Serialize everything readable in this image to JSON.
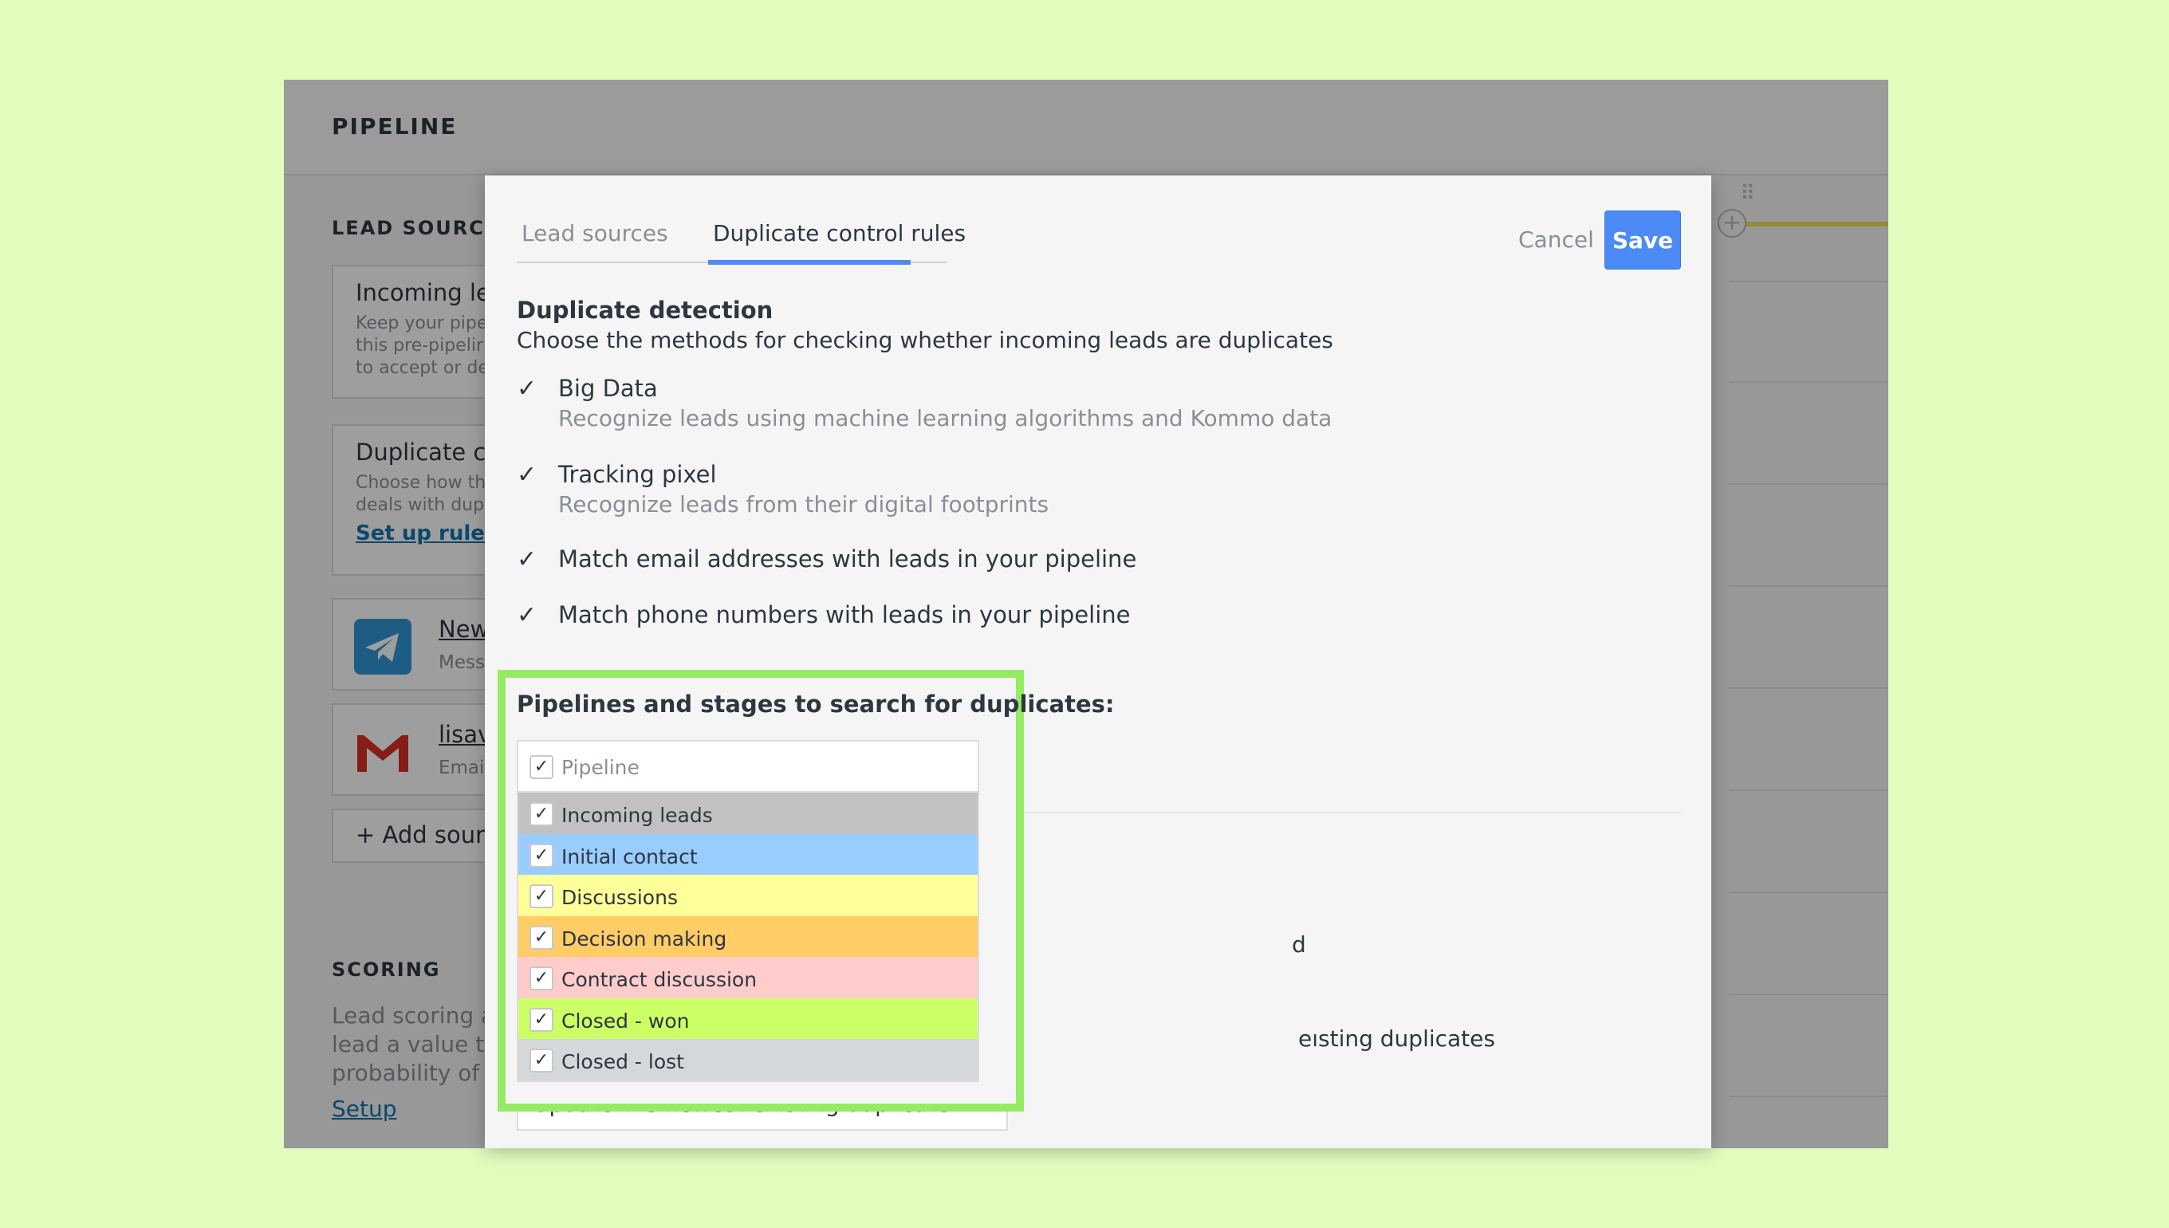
{
  "background": {
    "header": {
      "title": "PIPELINE"
    },
    "lead_sources": {
      "title": "LEAD SOURCES",
      "incoming_card": {
        "title": "Incoming lea",
        "desc": [
          "Keep your pipe",
          "this pre-pipelir",
          "to accept or de"
        ]
      },
      "duplicate_card": {
        "title": "Duplicate cor",
        "desc": [
          "Choose how th",
          "deals with dup"
        ],
        "link": "Set up rules"
      },
      "sources": [
        {
          "name": "Newb",
          "sub": "Messe",
          "icon": "telegram-icon",
          "color": "#2f97d3"
        },
        {
          "name": "lisave",
          "sub": "Email",
          "icon": "gmail-icon",
          "color": "#d93025"
        }
      ],
      "add_source": "Add sourc"
    },
    "scoring": {
      "title": "SCORING",
      "desc": [
        "Lead scoring all",
        "lead a value tha",
        "probability of c"
      ],
      "link": "Setup"
    }
  },
  "modal": {
    "tabs": [
      {
        "label": "Lead sources",
        "active": false
      },
      {
        "label": "Duplicate control rules",
        "active": true
      }
    ],
    "cancel_label": "Cancel",
    "save_label": "Save",
    "detection": {
      "title": "Duplicate detection",
      "desc": "Choose the methods for checking whether incoming leads are duplicates",
      "options": [
        {
          "label": "Big Data",
          "sub": "Recognize leads using machine learning algorithms and Kommo data",
          "checked": true
        },
        {
          "label": "Tracking pixel",
          "sub": "Recognize leads from their digital footprints",
          "checked": true
        },
        {
          "label": "Match email addresses with leads in your pipeline",
          "sub": "",
          "checked": true
        },
        {
          "label": "Match phone numbers with leads in your pipeline",
          "sub": "",
          "checked": true
        }
      ]
    },
    "pipelines": {
      "label": "Pipelines and stages to search for duplicates:",
      "header": {
        "label": "Pipeline",
        "checked": true
      },
      "stages": [
        {
          "label": "Incoming leads",
          "color": "#c1c1c1",
          "checked": true
        },
        {
          "label": "Initial contact",
          "color": "#99ccff",
          "checked": true
        },
        {
          "label": "Discussions",
          "color": "#ffff99",
          "checked": true
        },
        {
          "label": "Decision making",
          "color": "#ffcc66",
          "checked": true
        },
        {
          "label": "Contract discussion",
          "color": "#ffcccc",
          "checked": true
        },
        {
          "label": "Closed - won",
          "color": "#ccff66",
          "checked": true
        },
        {
          "label": "Closed - lost",
          "color": "#d5d8db",
          "checked": true
        }
      ]
    },
    "partial_text_1": "d",
    "partial_text_2": "eısting duplicates",
    "action_select": {
      "value": "Update the newest existing duplicate"
    },
    "highlight_color": "#96eb64"
  }
}
